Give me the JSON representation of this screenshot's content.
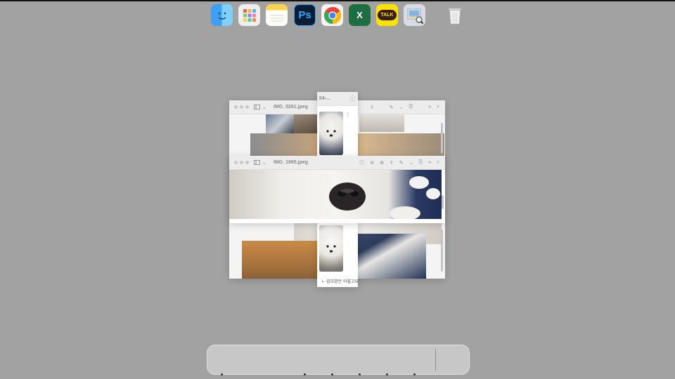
{
  "windows": {
    "back": {
      "title": "IMG_5261.jpeg"
    },
    "front": {
      "title": "IMG_1965.jpeg"
    },
    "narrow": {
      "title": "04-..."
    }
  },
  "caption": "ㄴ 입모양은 이렇고요",
  "dock": {
    "apps": [
      {
        "name": "Finder",
        "icon": "finder-icon"
      },
      {
        "name": "Launchpad",
        "icon": "launchpad-icon"
      },
      {
        "name": "Notes",
        "icon": "notes-icon"
      },
      {
        "name": "Photoshop",
        "icon": "photoshop-icon",
        "label": "Ps"
      },
      {
        "name": "Chrome",
        "icon": "chrome-icon"
      },
      {
        "name": "Excel",
        "icon": "excel-icon",
        "label": "X"
      },
      {
        "name": "KakaoTalk",
        "icon": "kakaotalk-icon",
        "label": "TALK"
      },
      {
        "name": "Preview",
        "icon": "preview-icon"
      },
      {
        "name": "Trash",
        "icon": "trash-icon"
      }
    ]
  }
}
